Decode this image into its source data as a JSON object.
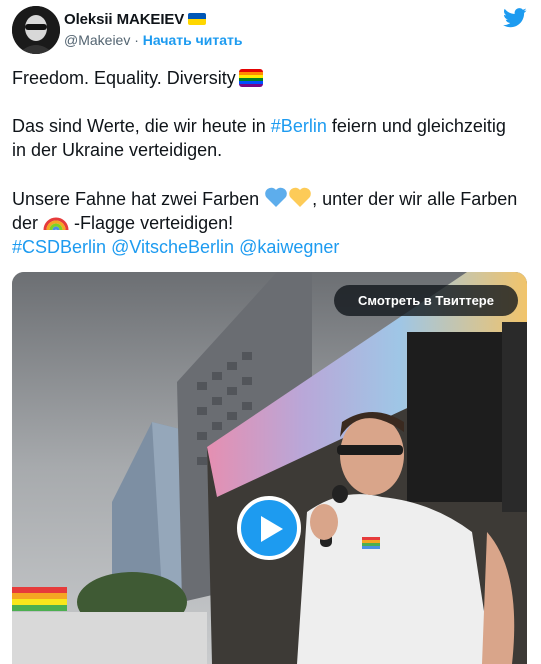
{
  "author": {
    "name": "Oleksii MAKEIEV",
    "handle": "@Makeiev",
    "separator": "·",
    "follow_label": "Начать читать",
    "flag_colors": [
      "#0057b7",
      "#ffd700"
    ]
  },
  "icons": {
    "brand": "twitter-bird-icon",
    "play": "play-icon"
  },
  "tweet": {
    "line1": "Freedom. Equality. Diversity",
    "line2_pre": "Das sind Werte, die wir heute in ",
    "line2_tag": "#Berlin",
    "line2_post": " feiern und gleichzeitig in der Ukraine verteidigen.",
    "line3_pre": "Unsere Fahne hat zwei Farben ",
    "line3_mid": ", unter der wir alle Farben der ",
    "line3_post": " -Flagge verteidigen!",
    "tags": [
      "#CSDBerlin",
      "@VitscheBerlin",
      "@kaiwegner"
    ]
  },
  "media": {
    "watch_label": "Смотреть в Твиттере"
  },
  "colors": {
    "accent": "#1d9bf0",
    "text": "#0f1419",
    "secondary": "#536471"
  }
}
